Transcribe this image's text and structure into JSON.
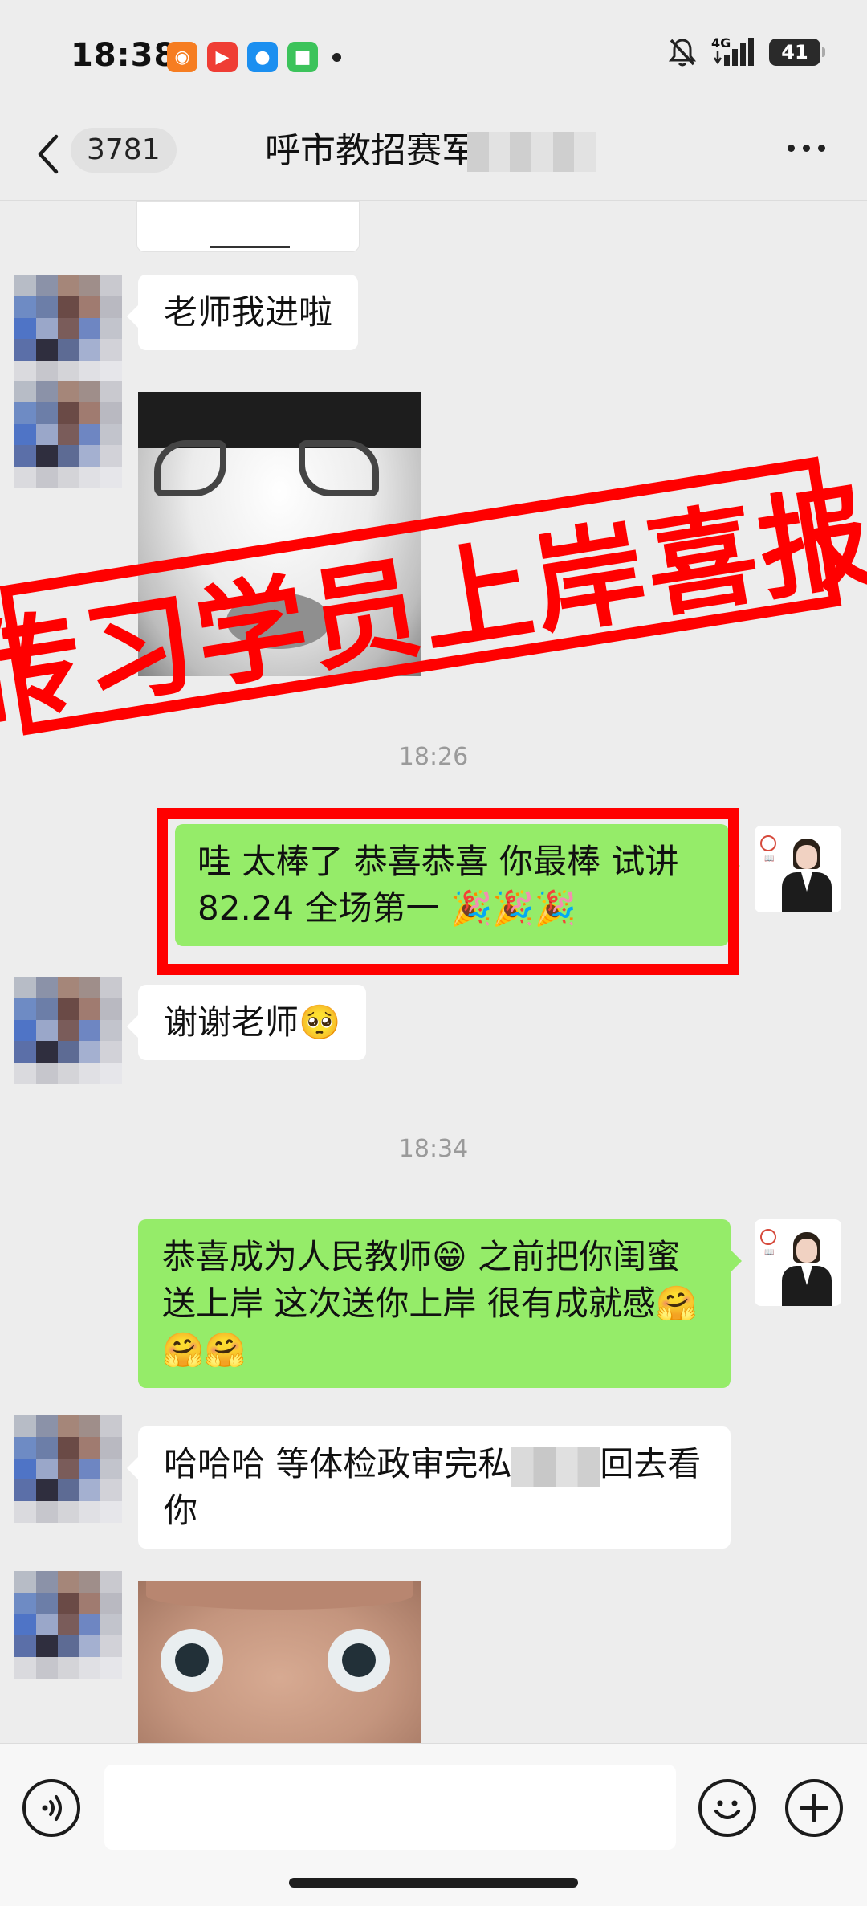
{
  "status_bar": {
    "time": "18:38",
    "network": "4G",
    "battery": "41",
    "notification_icons": [
      "orange-app-icon",
      "red-video-icon",
      "blue-app-icon",
      "green-message-icon"
    ]
  },
  "nav": {
    "back_count": "3781",
    "title": "呼市教招赛军"
  },
  "messages": [
    {
      "side": "left",
      "type": "text",
      "text": "老师我进啦"
    },
    {
      "side": "left",
      "type": "sticker",
      "icon": "panda-meme-sticker"
    },
    {
      "type": "time",
      "text": "18:26"
    },
    {
      "side": "right",
      "type": "text",
      "text": "哇 太棒了 恭喜恭喜  你最棒 试讲82.24 全场第一 🎉🎉🎉"
    },
    {
      "side": "left",
      "type": "text",
      "text": "谢谢老师🥺"
    },
    {
      "type": "time",
      "text": "18:34"
    },
    {
      "side": "right",
      "type": "text",
      "text": "恭喜成为人民教师😁 之前把你闺蜜送上岸 这次送你上岸 很有成就感🤗🤗🤗"
    },
    {
      "side": "left",
      "type": "text",
      "text_before": "哈哈哈 等体检政审完私",
      "text_after": "回去看你"
    },
    {
      "side": "left",
      "type": "sticker",
      "icon": "wide-eyes-sticker"
    }
  ],
  "stamp": {
    "text": "传习学员上岸喜报",
    "color": "#ff0000"
  },
  "colors": {
    "background": "#ededed",
    "my_bubble": "#95ec69",
    "their_bubble": "#ffffff",
    "highlight": "#ff0000"
  },
  "input_bar": {
    "voice_icon": "voice-icon",
    "emoji_icon": "emoji-icon",
    "plus_icon": "plus-icon"
  }
}
